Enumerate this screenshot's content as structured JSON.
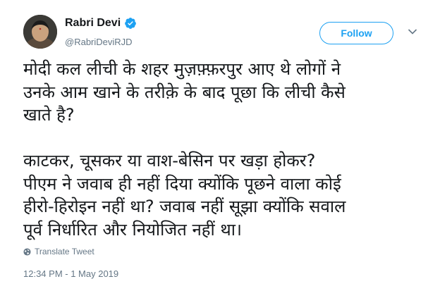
{
  "user": {
    "display_name": "Rabri Devi",
    "handle": "@RabriDeviRJD",
    "verified": true
  },
  "follow_button": {
    "label": "Follow"
  },
  "tweet": {
    "lines": [
      "मोदी कल लीची के शहर मुज़फ़्फ़रपुर आए थे लोगों ने",
      "उनके आम खाने के तरीक़े के बाद पूछा कि लीची कैसे",
      "खाते है?",
      "",
      "काटकर, चूसकर या वाश-बेसिन पर खड़ा होकर?",
      "पीएम ने जवाब ही नहीं दिया क्योंकि पूछने वाला कोई",
      "हीरो-हिरोइन नहीं था? जवाब नहीं सूझा क्योंकि सवाल",
      "पूर्व निर्धारित और नियोजित नहीं था।"
    ]
  },
  "translate": {
    "label": "Translate Tweet",
    "icon": "globe-icon"
  },
  "timestamp": "12:34 PM - 1 May 2019",
  "colors": {
    "accent": "#1da1f2",
    "muted": "#657786",
    "text": "#14171a"
  }
}
